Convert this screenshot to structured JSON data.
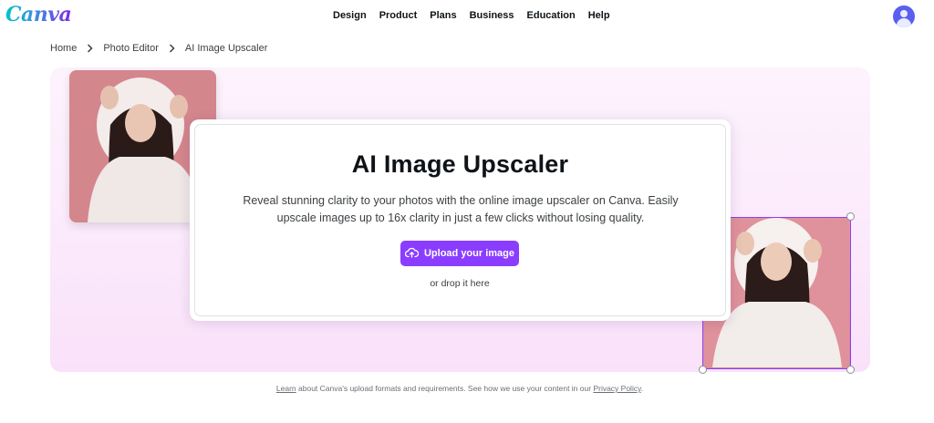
{
  "header": {
    "logo": "Canva",
    "nav": [
      "Design",
      "Product",
      "Plans",
      "Business",
      "Education",
      "Help"
    ]
  },
  "breadcrumb": {
    "items": [
      "Home",
      "Photo Editor",
      "AI Image Upscaler"
    ]
  },
  "hero": {
    "title": "AI Image Upscaler",
    "description": "Reveal stunning clarity to your photos with the online image upscaler on Canva. Easily upscale images up to 16x clarity in just a few clicks without losing quality.",
    "upload_label": "Upload your image",
    "drop_text": "or drop it here"
  },
  "footer": {
    "learn_link": "Learn",
    "text_middle": "about Canva's upload formats and requirements. See how we use your content in our",
    "privacy_link": "Privacy Policy",
    "text_end": "."
  },
  "colors": {
    "accent": "#8b3dff",
    "avatar": "#5a5ff0",
    "hero_bg": "#fbe9fb"
  },
  "icons": [
    "user-avatar-icon",
    "chevron-right-icon",
    "cloud-upload-icon"
  ]
}
